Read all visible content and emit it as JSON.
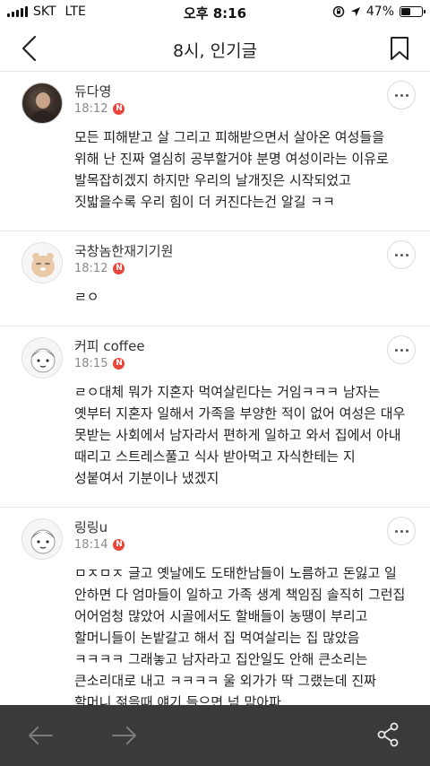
{
  "status_bar": {
    "carrier": "SKT",
    "network": "LTE",
    "time": "오후 8:16",
    "battery": "47%",
    "battery_level": 0.47
  },
  "header": {
    "title": "8시, 인기글",
    "back_icon": "chevron-left-icon",
    "bookmark_icon": "bookmark-icon"
  },
  "comments": [
    {
      "nickname": "듀다영",
      "time": "18:12",
      "badge": "N",
      "body": "모든 피해받고 살 그리고 피해받으면서 살아온 여성들을 위해 난 진짜 열심히 공부할거야 분명 여성이라는 이유로 발목잡히겠지 하지만 우리의 날개짓은 시작되었고 짓밟을수록 우리 힘이 더 커진다는건 알길 ㅋㅋ"
    },
    {
      "nickname": "국창놈한재기기원",
      "time": "18:12",
      "badge": "N",
      "body": "ㄹㅇ"
    },
    {
      "nickname": "커피 coffee",
      "time": "18:15",
      "badge": "N",
      "body": "ㄹㅇ대체 뭐가 지혼자 먹여살린다는 거임ㅋㅋㅋ 남자는 옛부터 지혼자 일해서 가족을 부양한 적이 없어 여성은 대우 못받는 사회에서 남자라서 편하게 일하고 와서 집에서 아내 때리고 스트레스풀고 식사 받아먹고 자식한테는 지 성붙여서 기분이나 냈겠지"
    },
    {
      "nickname": "링링u",
      "time": "18:14",
      "badge": "N",
      "body": "ㅁㅈㅁㅈ 글고 옛날에도 도태한남들이 노름하고 돈잃고 일 안하면 다 엄마들이 일하고 가족 생계 책임짐 솔직히 그런집 어어엄청 많았어 시골에서도 할배들이 농땡이 부리고 할머니들이 논밭갈고 해서 집 먹여살리는 집 많았음 ㅋㅋㅋㅋ 그래놓고 남자라고 집안일도 안해 큰소리는 큰소리대로 내고 ㅋㅋㅋㅋ 울 외가가 딱 그랬는데 진짜 할머니 젊을때 얘기 들으면 넘 맘아파"
    }
  ],
  "bottom_bar": {
    "prev_icon": "arrow-left-icon",
    "next_icon": "arrow-right-icon",
    "share_icon": "share-icon"
  },
  "colors": {
    "badge": "#e8473b",
    "bottom_bar": "#3a3a3c",
    "divider": "#ebebeb"
  }
}
